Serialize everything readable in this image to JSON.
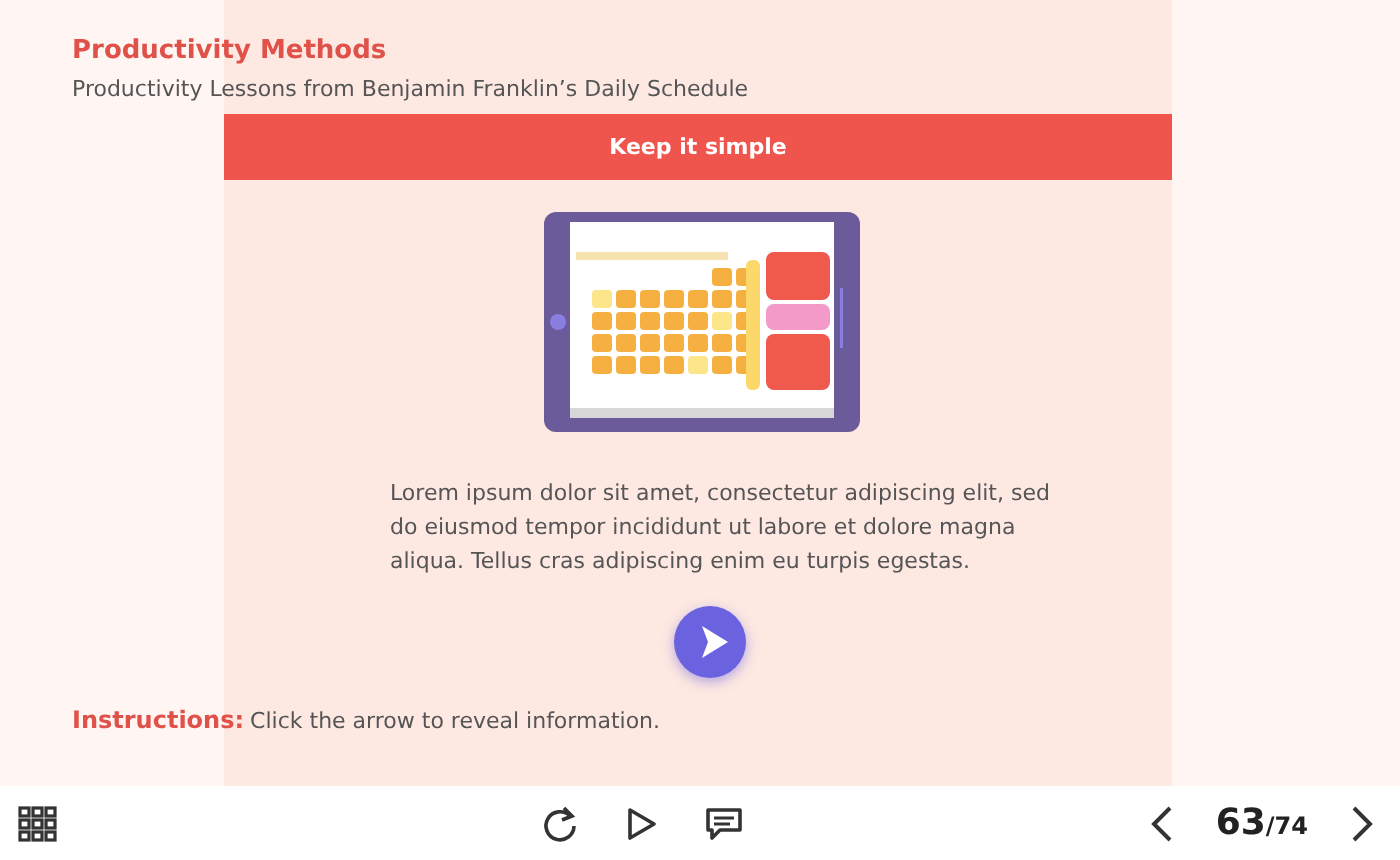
{
  "slide": {
    "title": "Productivity Methods",
    "subtitle": "Productivity Lessons from Benjamin Franklin’s Daily Schedule",
    "banner": "Keep it simple",
    "paragraph": "Lorem ipsum dolor sit amet, consectetur adipiscing elit, sed do eiusmod tempor incididunt ut labore et dolore magna aliqua. Tellus cras adipiscing enim eu turpis egestas.",
    "instructions_label": "Instructions:",
    "instructions_text": "Click the arrow to reveal information."
  },
  "toolbar": {
    "current_page": "63",
    "total_pages": "/74"
  }
}
